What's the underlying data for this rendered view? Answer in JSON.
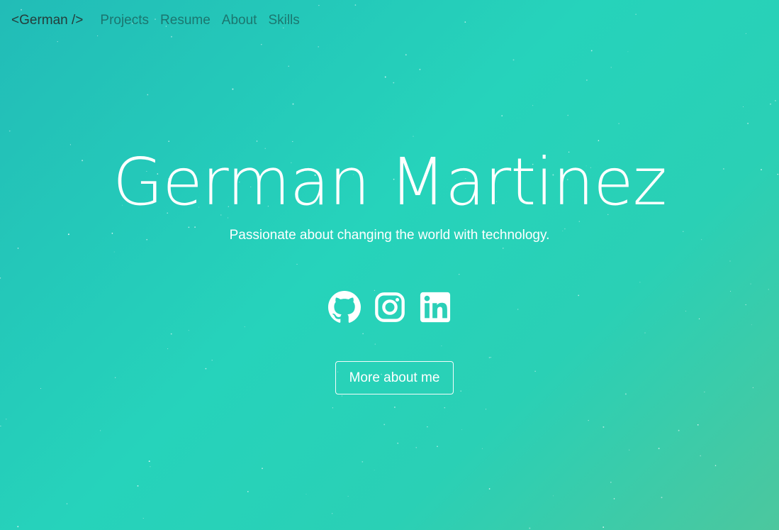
{
  "navbar": {
    "brand": "<German />",
    "links": [
      "Projects",
      "Resume",
      "About",
      "Skills"
    ]
  },
  "hero": {
    "title": "German Martinez",
    "subtitle": "Passionate about changing the world with technology.",
    "socials": [
      {
        "icon": "github-icon"
      },
      {
        "icon": "instagram-icon"
      },
      {
        "icon": "linkedin-icon"
      }
    ],
    "cta_label": "More about me"
  },
  "colors": {
    "gradient_start": "#22bcb7",
    "gradient_mid": "#26d3bb",
    "gradient_end": "#4cc79e",
    "text": "#ffffff",
    "brand_text": "#243d3b",
    "nav_text": "#5d8e88"
  }
}
